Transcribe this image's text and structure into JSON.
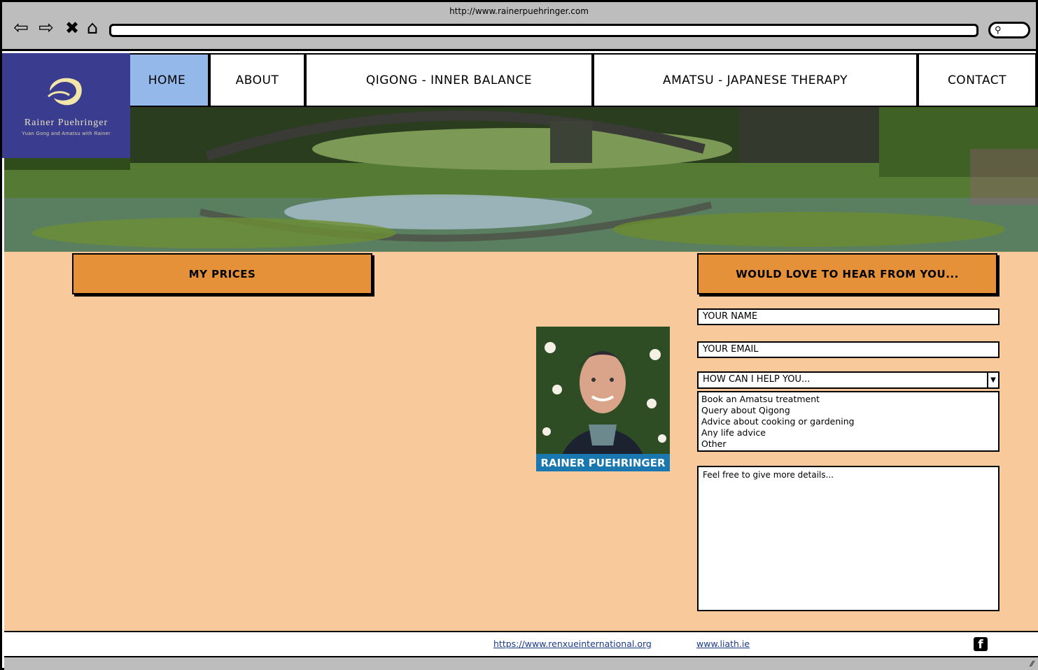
{
  "browser": {
    "url": "http://www.rainerpuehringer.com",
    "back_icon": "back-arrow-icon",
    "forward_icon": "forward-arrow-icon",
    "close_icon": "close-icon",
    "home_icon": "home-icon",
    "search_icon": "search-icon"
  },
  "logo": {
    "name": "Rainer Puehringer",
    "tagline": "Yuan Gong and Amatsu with Rainer",
    "bg_color": "#3a3c8f"
  },
  "nav": {
    "tabs": [
      {
        "label": "HOME",
        "active": true
      },
      {
        "label": "ABOUT",
        "active": false
      },
      {
        "label": "QIGONG - INNER BALANCE",
        "active": false
      },
      {
        "label": "AMATSU - JAPANESE THERAPY",
        "active": false
      },
      {
        "label": "CONTACT",
        "active": false
      }
    ],
    "active_color": "#94b8ea"
  },
  "main": {
    "prices_header": "MY PRICES",
    "contact_header": "WOULD LOVE TO HEAR FROM YOU...",
    "portrait_caption": "RAINER PUEHRINGER",
    "form": {
      "name_placeholder": "YOUR NAME",
      "email_placeholder": "YOUR EMAIL",
      "help_select": "HOW CAN I HELP YOU...",
      "options": [
        "Book an Amatsu treatment",
        "Query about Qigong",
        "Advice about cooking or gardening",
        "Any life advice",
        "Other"
      ],
      "details_placeholder": "Feel free to give more details..."
    },
    "bg_color": "#f8c99b",
    "header_color": "#e5913a"
  },
  "footer": {
    "link1": "https://www.renxueinternational.org",
    "link2": "www.liath.ie",
    "social_icon": "facebook-icon"
  }
}
